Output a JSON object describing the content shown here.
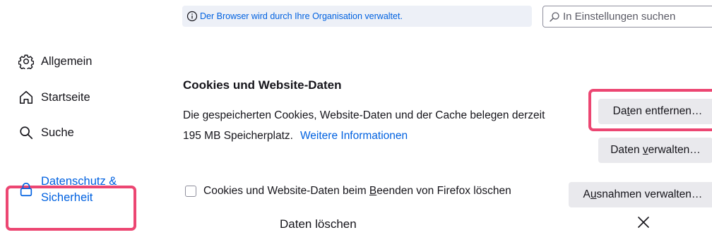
{
  "header": {
    "policy_notice": "Der Browser wird durch Ihre Organisation verwaltet.",
    "search_placeholder": "In Einstellungen suchen"
  },
  "sidebar": {
    "items": [
      {
        "label": "Allgemein",
        "icon": "gear-icon"
      },
      {
        "label": "Startseite",
        "icon": "home-icon"
      },
      {
        "label": "Suche",
        "icon": "search-icon"
      },
      {
        "label_line1": "Datenschutz &",
        "label_line2": "Sicherheit",
        "icon": "lock-icon",
        "active": true
      }
    ]
  },
  "cookies_section": {
    "title": "Cookies und Website-Daten",
    "description_line1": "Die gespeicherten Cookies, Website-Daten und der Cache belegen derzeit",
    "description_line2": "195 MB Speicherplatz.",
    "more_info_link": "Weitere Informationen",
    "clear_data_button": {
      "before": "Da",
      "accel": "t",
      "after": "en entfernen…"
    },
    "manage_data_button": {
      "before": "Daten ",
      "accel": "v",
      "after": "erwalten…"
    },
    "manage_exceptions_button": {
      "before": "A",
      "accel": "u",
      "after": "snahmen verwalten…"
    },
    "delete_on_close_checkbox": {
      "before": "Cookies und Website-Daten beim ",
      "accel": "B",
      "after": "eenden von Firefox löschen",
      "checked": false
    }
  },
  "dialog": {
    "title": "Daten löschen"
  },
  "colors": {
    "accent": "#0061e0",
    "highlight": "#ec4672",
    "button_bg": "#e9e9ed",
    "banner_bg": "#edf0f7"
  }
}
